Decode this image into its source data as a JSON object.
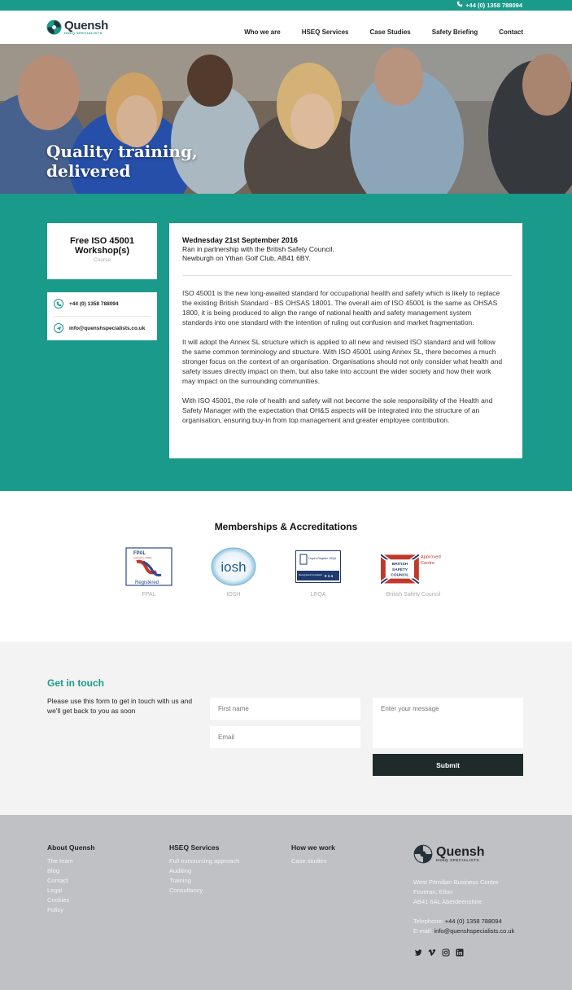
{
  "topbar": {
    "phone": "+44 (0) 1358 788094"
  },
  "brand": {
    "name": "Quensh",
    "tagline": "HSEQ SPECIALISTS"
  },
  "nav": {
    "items": [
      "Who we are",
      "HSEQ Services",
      "Case Studies",
      "Safety Briefing",
      "Contact"
    ]
  },
  "hero": {
    "title_line1": "Quality training,",
    "title_line2": "delivered"
  },
  "course": {
    "title": "Free ISO 45001 Workshop(s)",
    "type": "Course"
  },
  "contact": {
    "phone": "+44 (0) 1358 788094",
    "email": "info@quenshspecialists.co.uk"
  },
  "event": {
    "date": "Wednesday 21st September 2016",
    "partner": "Ran in partnership with the British Safety Council.",
    "venue": "Newburgh on Ythan Golf Club, AB41 6BY."
  },
  "paragraphs": [
    "ISO 45001 is the new long-awaited standard for occupational health and safety which is likely to replace the existing British Standard - BS OHSAS 18001. The overall aim of ISO 45001 is the same as OHSAS 1800, it is being produced to align the range of national health and safety management system standards into one standard with the intention of ruling out confusion and market fragmentation.",
    "It will adopt the Annex SL structure which is applied to all new and revised ISO standard and will follow the same common terminology and structure. With ISO 45001 using Annex SL, there becomes a much stronger focus on the context of an organisation. Organisations should not only consider what health and safety issues directly impact on them, but also take into account the wider society and how their work may impact on the surrounding communities.",
    "With ISO 45001, the role of health and safety will not become the sole responsibility of the Health and Safety Manager with the expectation that OH&S aspects will be integrated into the structure of an organisation, ensuring buy-in from top management and greater employee contribution."
  ],
  "memberships": {
    "title": "Memberships & Accreditations",
    "badges": [
      {
        "name": "FPAL",
        "logo_top": "FPAL",
        "logo_sub": "powered by Achilles",
        "logo_bottom": "Registered"
      },
      {
        "name": "IOSH",
        "logo_text": "iosh"
      },
      {
        "name": "LRQA",
        "logo_top": "Lloyd's Register LRQA",
        "logo_bottom": "Recognised Consultant",
        "logo_num": "0 1 4"
      },
      {
        "name": "British Safety Council",
        "logo_text": "BRITISH SAFETY COUNCIL",
        "logo_badge": "Approved Centre"
      }
    ]
  },
  "touch": {
    "title": "Get in touch",
    "text": "Please use this form to get in touch with us and we'll get back to you as soon",
    "first_name_placeholder": "First name",
    "email_placeholder": "Email",
    "message_placeholder": "Enter your message",
    "submit": "Submit"
  },
  "footer": {
    "col1": {
      "heading": "About Quensh",
      "links": [
        "The team",
        "Blog",
        "Contact",
        "Legal",
        "Cookies",
        "Policy"
      ]
    },
    "col2": {
      "heading": "HSEQ Services",
      "links": [
        "Full outsourcing approach",
        "Auditing",
        "Training",
        "Consultancy"
      ]
    },
    "col3": {
      "heading": "How we work",
      "links": [
        "Case studies"
      ]
    },
    "address": [
      "West Pitmillan Business Centre",
      "Foveran, Ellon",
      "AB41 6AL Aberdeenshire"
    ],
    "telephone_label": "Telephone:",
    "telephone": "+44 (0) 1358 788094",
    "email_label": "E-mail:",
    "email": "info@quenshspecialists.co.uk"
  },
  "colors": {
    "teal": "#1a9a8a",
    "dark": "#1f2a2a",
    "footer_bg": "#bfc1c4"
  },
  "icons": [
    "phone-icon",
    "email-icon",
    "twitter-icon",
    "vimeo-icon",
    "instagram-icon",
    "linkedin-icon"
  ]
}
